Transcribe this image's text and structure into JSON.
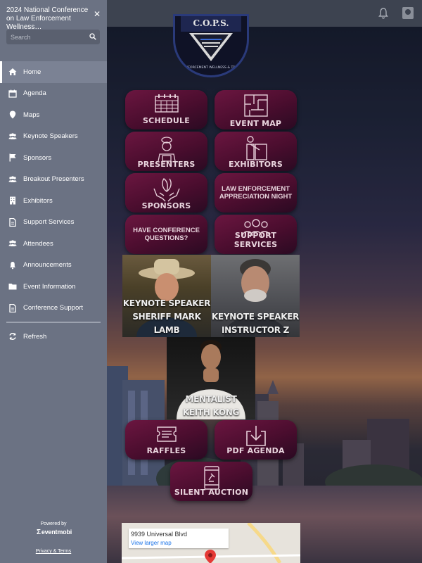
{
  "sidebar": {
    "title": "2024 National Conference on Law Enforcement Wellness…",
    "search_placeholder": "Search",
    "nav": [
      {
        "label": "Home",
        "icon": "home-icon",
        "active": true
      },
      {
        "label": "Agenda",
        "icon": "calendar-icon"
      },
      {
        "label": "Maps",
        "icon": "map-pin-icon"
      },
      {
        "label": "Keynote Speakers",
        "icon": "people-icon"
      },
      {
        "label": "Sponsors",
        "icon": "flag-icon"
      },
      {
        "label": "Breakout Presenters",
        "icon": "people-icon"
      },
      {
        "label": "Exhibitors",
        "icon": "building-icon"
      },
      {
        "label": "Support Services",
        "icon": "document-icon"
      },
      {
        "label": "Attendees",
        "icon": "people-icon"
      },
      {
        "label": "Announcements",
        "icon": "bell-icon"
      },
      {
        "label": "Event Information",
        "icon": "folder-icon"
      },
      {
        "label": "Conference Support",
        "icon": "document-icon"
      }
    ],
    "refresh_label": "Refresh",
    "powered_by": "Powered by",
    "brand": "eventmobi",
    "privacy": "Privacy & Terms"
  },
  "tiles": {
    "schedule": "SCHEDULE",
    "event_map": "EVENT MAP",
    "presenters": "PRESENTERS",
    "exhibitors": "EXHIBITORS",
    "sponsors": "SPONSORS",
    "appreciation": "LAW ENFORCEMENT APPRECIATION NIGHT",
    "questions": "HAVE CONFERENCE QUESTIONS?",
    "support": "SUPPORT SERVICES",
    "raffles": "RAFFLES",
    "pdf_agenda": "PDF AGENDA",
    "silent_auction": "SILENT AUCTION"
  },
  "speakers": [
    {
      "line1": "KEYNOTE SPEAKER",
      "line2": "SHERIFF MARK LAMB"
    },
    {
      "line1": "KEYNOTE SPEAKER",
      "line2": "INSTRUCTOR Z"
    },
    {
      "line1": "MENTALIST",
      "line2": "KEITH KONG"
    }
  ],
  "map": {
    "address": "9939 Universal Blvd",
    "link": "View larger map"
  },
  "logo_text": "C.O.P.S.",
  "logo_sub": "LAW ENFORCEMENT WELLNESS & TRAINING",
  "colors": {
    "sidebar": "#6b7283",
    "tile": "#6b1640",
    "topbar": "#3d4350"
  }
}
